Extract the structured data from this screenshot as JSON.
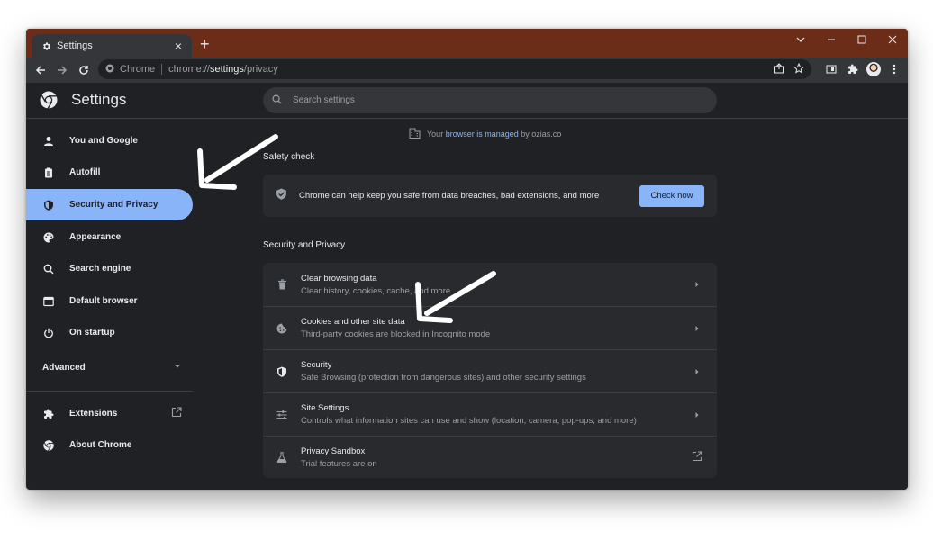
{
  "window": {
    "tab_title": "Settings",
    "tab_close": "×",
    "new_tab": "+"
  },
  "toolbar": {
    "chip_label": "Chrome",
    "url_prefix": "chrome://",
    "url_host": "settings",
    "url_path": "/privacy"
  },
  "header": {
    "title": "Settings",
    "search_placeholder": "Search settings"
  },
  "sidebar": {
    "items": [
      {
        "label": "You and Google",
        "icon": "person-icon"
      },
      {
        "label": "Autofill",
        "icon": "clipboard-icon"
      },
      {
        "label": "Security and Privacy",
        "icon": "shield-icon",
        "active": true
      },
      {
        "label": "Appearance",
        "icon": "palette-icon"
      },
      {
        "label": "Search engine",
        "icon": "search-icon"
      },
      {
        "label": "Default browser",
        "icon": "browser-window-icon"
      },
      {
        "label": "On startup",
        "icon": "power-icon"
      }
    ],
    "advanced_label": "Advanced",
    "extensions_label": "Extensions",
    "about_label": "About Chrome"
  },
  "main": {
    "managed": {
      "prefix": "Your",
      "link": "browser is managed",
      "suffix": "by ozias.co"
    },
    "safety_check": {
      "heading": "Safety check",
      "text": "Chrome can help keep you safe from data breaches, bad extensions, and more",
      "button": "Check now"
    },
    "privacy_section": {
      "heading": "Security and Privacy",
      "rows": [
        {
          "title": "Clear browsing data",
          "subtitle": "Clear history, cookies, cache, and more",
          "icon": "trash-icon",
          "action": "chevron-right-icon"
        },
        {
          "title": "Cookies and other site data",
          "subtitle": "Third-party cookies are blocked in Incognito mode",
          "icon": "cookie-icon",
          "action": "chevron-right-icon"
        },
        {
          "title": "Security",
          "subtitle": "Safe Browsing (protection from dangerous sites) and other security settings",
          "icon": "shield-icon",
          "action": "chevron-right-icon"
        },
        {
          "title": "Site Settings",
          "subtitle": "Controls what information sites can use and show (location, camera, pop-ups, and more)",
          "icon": "sliders-icon",
          "action": "chevron-right-icon"
        },
        {
          "title": "Privacy Sandbox",
          "subtitle": "Trial features are on",
          "icon": "flask-icon",
          "action": "external-link-icon"
        }
      ]
    }
  },
  "colors": {
    "titlebar": "#6b2d18",
    "accent": "#8ab4f8",
    "background": "#202124",
    "card": "#292a2d"
  }
}
